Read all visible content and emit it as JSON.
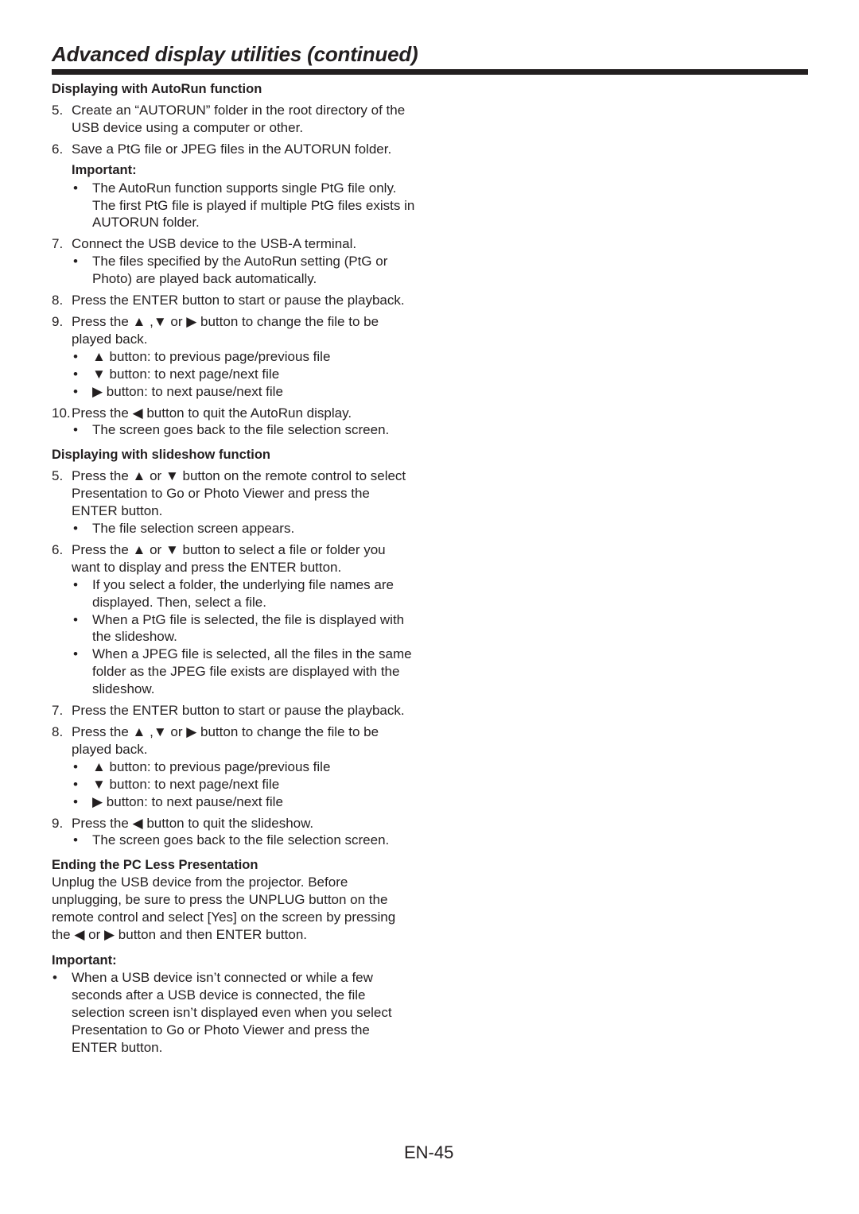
{
  "header": {
    "title": "Advanced display utilities (continued)"
  },
  "autorun": {
    "heading": "Displaying with AutoRun function",
    "step5": {
      "num": "5.",
      "text": "Create an “AUTORUN” folder in the root directory of the USB device using a computer or other."
    },
    "step6": {
      "num": "6.",
      "text": "Save a PtG file or JPEG files in the AUTORUN folder."
    },
    "important_label": "Important:",
    "important_bullet": "The AutoRun function supports single PtG file only. The first PtG file is played if multiple PtG files exists in AUTORUN folder.",
    "step7": {
      "num": "7.",
      "text": "Connect the USB device to the USB-A terminal.",
      "bullet": "The files specified by the AutoRun setting (PtG or Photo) are played back automatically."
    },
    "step8": {
      "num": "8.",
      "text": "Press the ENTER button to start or pause the playback."
    },
    "step9": {
      "num": "9.",
      "text_a": "Press the ",
      "text_b": " ,",
      "text_c": " or ",
      "text_d": " button to change the file to be played back.",
      "bullets": [
        {
          "icon": "▲",
          "text": " button:  to previous page/previous file"
        },
        {
          "icon": "▼",
          "text": " button:  to next page/next file"
        },
        {
          "icon": "▶",
          "text": " button:  to next pause/next file"
        }
      ]
    },
    "step10": {
      "num": "10.",
      "text_a": "Press the ",
      "text_b": " button to quit the AutoRun display.",
      "bullet": "The screen goes back to the file selection screen."
    }
  },
  "slideshow": {
    "heading": "Displaying with slideshow function",
    "step5": {
      "num": "5.",
      "text_a": "Press the ",
      "text_b": " or ",
      "text_c": " button on the remote control to select Presentation to Go or Photo Viewer and press the ENTER button.",
      "bullet": "The file selection screen appears."
    },
    "step6": {
      "num": "6.",
      "text_a": "Press the ",
      "text_b": " or ",
      "text_c": " button to select a file or folder you want to display and press the ENTER button.",
      "bullets": [
        "If you select a folder, the underlying file names are displayed. Then, select a file.",
        "When a PtG file is selected, the file is displayed with the slideshow.",
        "When a JPEG file is selected, all the files in the same folder as the JPEG file exists are displayed with the slideshow."
      ]
    },
    "step7": {
      "num": "7.",
      "text": "Press the ENTER button to start or pause the playback."
    },
    "step8": {
      "num": "8.",
      "text_a": "Press the ",
      "text_b": " ,",
      "text_c": " or ",
      "text_d": " button to change the file to be played back.",
      "bullets": [
        {
          "icon": "▲",
          "text": " button:  to previous page/previous file"
        },
        {
          "icon": "▼",
          "text": " button:  to next page/next file"
        },
        {
          "icon": "▶",
          "text": " button:  to next pause/next file"
        }
      ]
    },
    "step9": {
      "num": "9.",
      "text_a": "Press the ",
      "text_b": " button to quit the slideshow.",
      "bullet": "The screen goes back to the file selection screen."
    }
  },
  "ending": {
    "heading": "Ending the PC Less Presentation",
    "text_a": "Unplug the USB device from the projector. Before unplugging, be sure to press the UNPLUG button on the remote control and select [Yes] on the screen by pressing the ",
    "text_b": " or ",
    "text_c": " button and then ENTER button.",
    "important_label": "Important:",
    "important_bullet": "When a USB device isn’t connected or while a few seconds after a USB device is connected, the file selection screen isn’t displayed even when you select Presentation to Go or Photo Viewer and press the ENTER button."
  },
  "icons": {
    "up": "▲",
    "down": "▼",
    "right": "▶",
    "left": "◀",
    "bullet": "•"
  },
  "footer": {
    "page_number": "EN-45"
  }
}
